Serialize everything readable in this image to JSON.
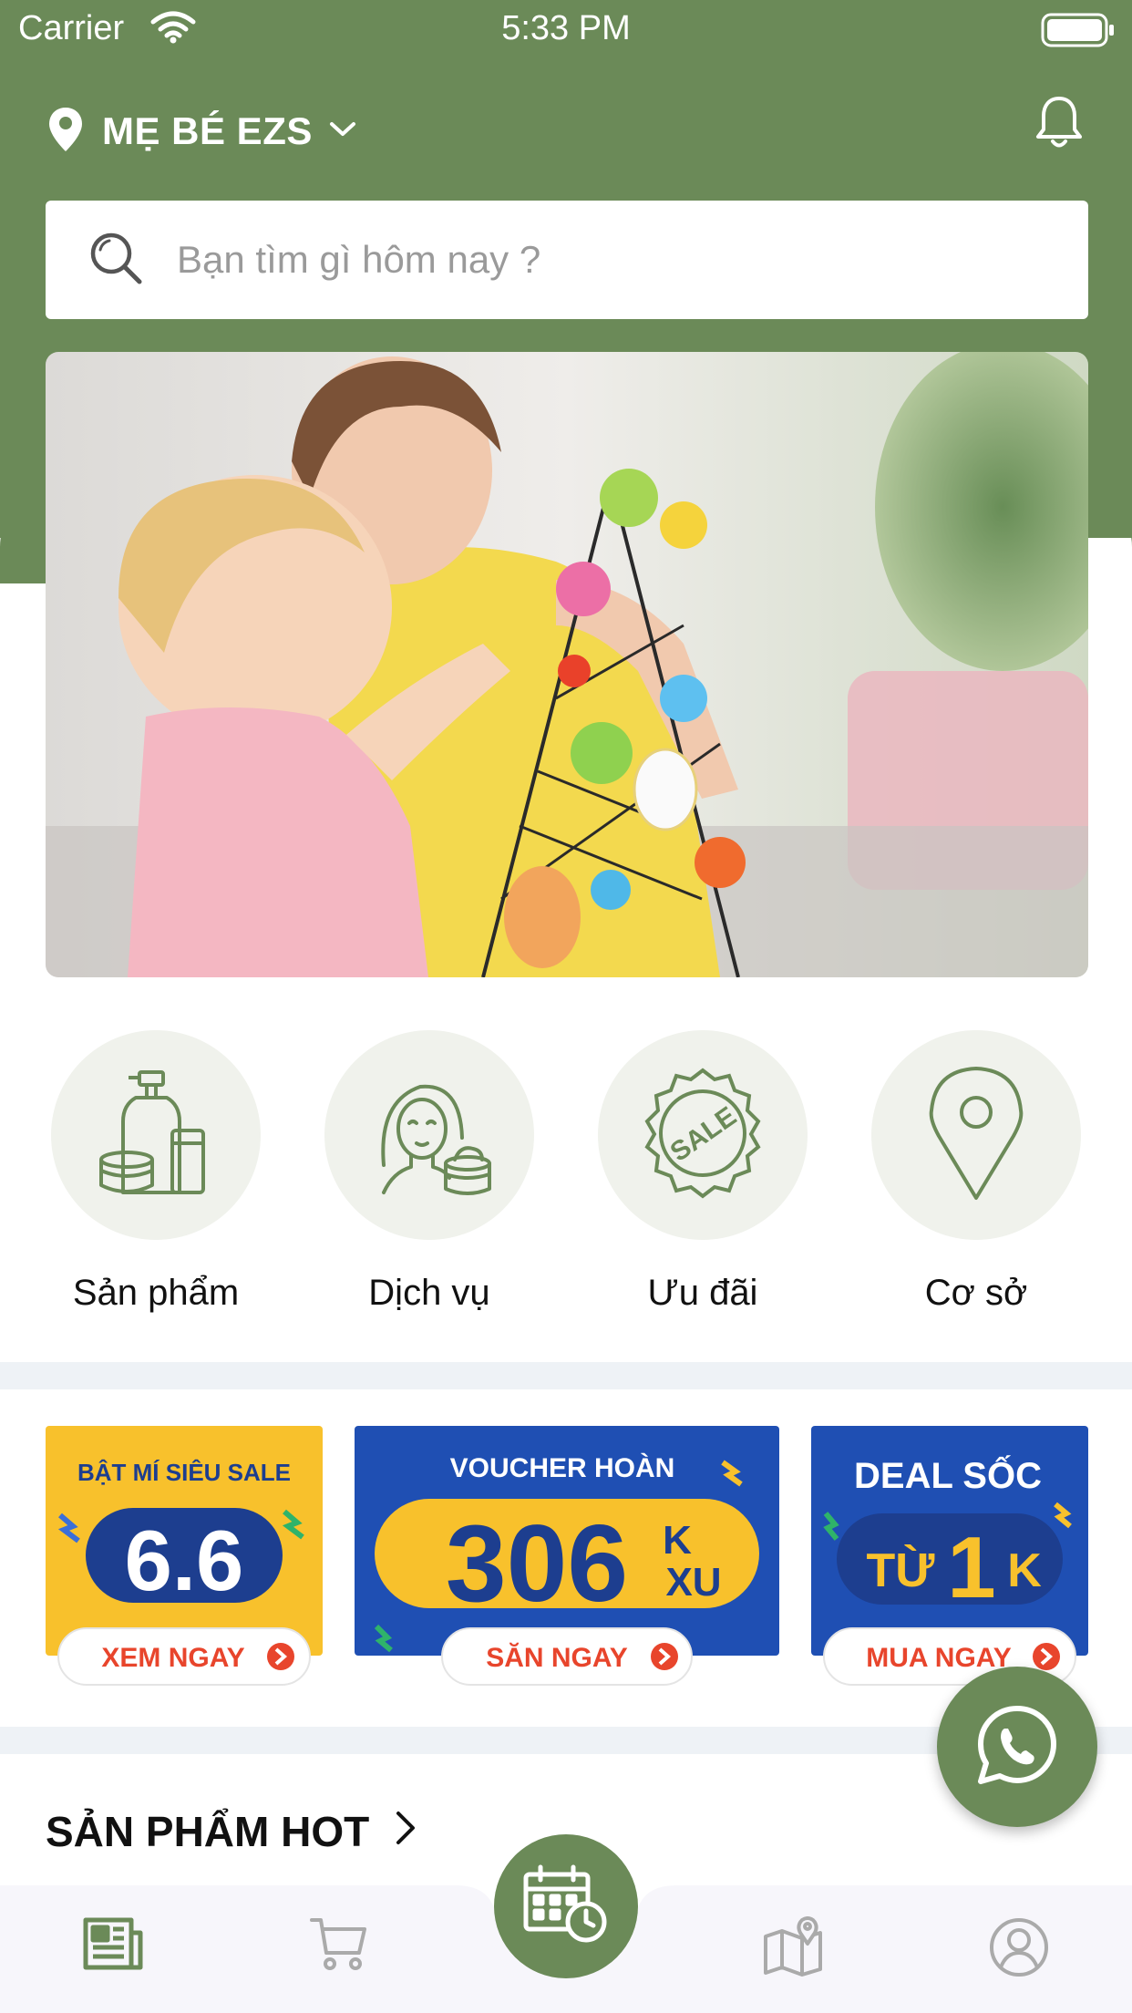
{
  "status_bar": {
    "carrier": "Carrier",
    "time": "5:33 PM"
  },
  "header": {
    "location": "MẸ BÉ EZS"
  },
  "search": {
    "placeholder": "Bạn tìm gì hôm nay ?"
  },
  "categories": [
    {
      "label": "Sản phẩm",
      "icon": "cosmetics-icon"
    },
    {
      "label": "Dịch vụ",
      "icon": "beauty-service-icon"
    },
    {
      "label": "Ưu đãi",
      "icon": "sale-badge-icon"
    },
    {
      "label": "Cơ sở",
      "icon": "location-pin-icon"
    }
  ],
  "promos": [
    {
      "top_text": "BẬT MÍ SIÊU SALE",
      "big_text": "6.6",
      "cta": "XEM NGAY"
    },
    {
      "top_text": "VOUCHER HOÀN",
      "big_text": "306",
      "suffix_top": "K",
      "suffix_bottom": "XU",
      "cta": "SĂN NGAY"
    },
    {
      "top_text": "DEAL SỐC",
      "big_text": "TỪ",
      "big_number": "1",
      "big_unit": "K",
      "cta": "MUA NGAY"
    }
  ],
  "section": {
    "hot_title": "SẢN PHẨM HOT"
  },
  "bottom_nav": [
    "news-icon",
    "cart-icon",
    "calendar-clock-icon",
    "map-icon",
    "profile-icon"
  ],
  "colors": {
    "brand_green": "#6b8a58",
    "category_bg": "#f0f2ec",
    "promo_yellow": "#f8c12c",
    "promo_blue": "#1f4fb3",
    "cta_red": "#e8452c"
  }
}
